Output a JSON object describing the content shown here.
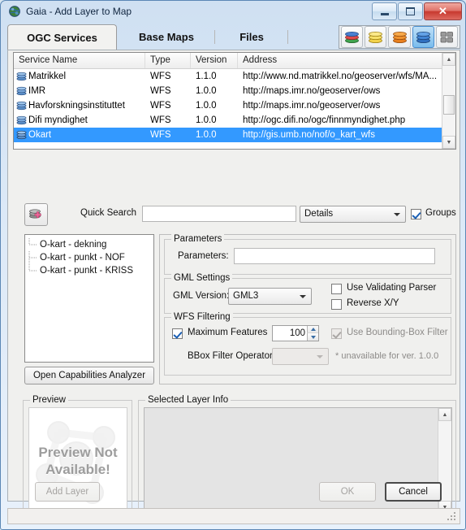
{
  "window": {
    "title": "Gaia - Add Layer to Map",
    "app_icon": "globe-icon",
    "minimize_label": "Minimize",
    "maximize_label": "Maximize",
    "close_label": "✕"
  },
  "tabs": [
    {
      "label": "OGC Services",
      "selected": true
    },
    {
      "label": "Base Maps",
      "selected": false
    },
    {
      "label": "Files",
      "selected": false
    }
  ],
  "toolbar": {
    "buttons": [
      {
        "name": "layers-multicolor-icon",
        "active": false
      },
      {
        "name": "layers-yellow-icon",
        "active": false
      },
      {
        "name": "layers-orange-icon",
        "active": false
      },
      {
        "name": "layers-blue-icon",
        "active": true
      },
      {
        "name": "tiles-grid-icon",
        "active": false
      }
    ]
  },
  "service_list": {
    "columns": [
      "Service Name",
      "Type",
      "Version",
      "Address"
    ],
    "rows": [
      {
        "name": "Matrikkel",
        "type": "WFS",
        "version": "1.1.0",
        "address": "http://www.nd.matrikkel.no/geoserver/wfs/MA...",
        "selected": false
      },
      {
        "name": "IMR",
        "type": "WFS",
        "version": "1.0.0",
        "address": "http://maps.imr.no/geoserver/ows",
        "selected": false
      },
      {
        "name": "Havforskningsinstituttet",
        "type": "WFS",
        "version": "1.0.0",
        "address": "http://maps.imr.no/geoserver/ows",
        "selected": false
      },
      {
        "name": "Difi myndighet",
        "type": "WFS",
        "version": "1.0.0",
        "address": "http://ogc.difi.no/ogc/finnmyndighet.php",
        "selected": false
      },
      {
        "name": "Okart",
        "type": "WFS",
        "version": "1.0.0",
        "address": "http://gis.umb.no/nof/o_kart_wfs",
        "selected": true
      }
    ]
  },
  "quick_search": {
    "add_button_icon": "add-layer-icon",
    "label": "Quick Search",
    "input_value": "",
    "input_placeholder": "",
    "details_combo_value": "Details",
    "groups_checkbox_label": "Groups",
    "groups_checked": true
  },
  "layer_tree": {
    "items": [
      {
        "label": "O-kart - dekning"
      },
      {
        "label": "O-kart - punkt - NOF"
      },
      {
        "label": "O-kart - punkt - KRISS"
      }
    ],
    "capabilities_button": "Open Capabilities Analyzer"
  },
  "parameters_group": {
    "title": "Parameters",
    "field_label": "Parameters:",
    "field_value": ""
  },
  "gml_group": {
    "title": "GML Settings",
    "version_label": "GML Version:",
    "version_value": "GML3",
    "validating_parser_label": "Use Validating Parser",
    "validating_parser_checked": false,
    "reverse_xy_label": "Reverse X/Y",
    "reverse_xy_checked": false
  },
  "wfs_group": {
    "title": "WFS Filtering",
    "max_features_label": "Maximum Features",
    "max_features_checked": true,
    "max_features_value": "100",
    "bbox_filter_label": "Use Bounding-Box Filter",
    "bbox_filter_checked": true,
    "bbox_filter_disabled": true,
    "bbox_operator_label": "BBox Filter Operator:",
    "bbox_operator_value": "",
    "unavailable_note": "* unavailable for ver. 1.0.0"
  },
  "preview": {
    "title": "Preview",
    "message_line1": "Preview Not",
    "message_line2": "Available!"
  },
  "layer_info": {
    "title": "Selected Layer Info",
    "content": ""
  },
  "footer": {
    "add_layer": "Add Layer",
    "ok": "OK",
    "cancel": "Cancel"
  },
  "colors": {
    "selection_blue": "#3399ff",
    "close_red": "#c8392f",
    "active_tool_blue": "#79bced"
  }
}
